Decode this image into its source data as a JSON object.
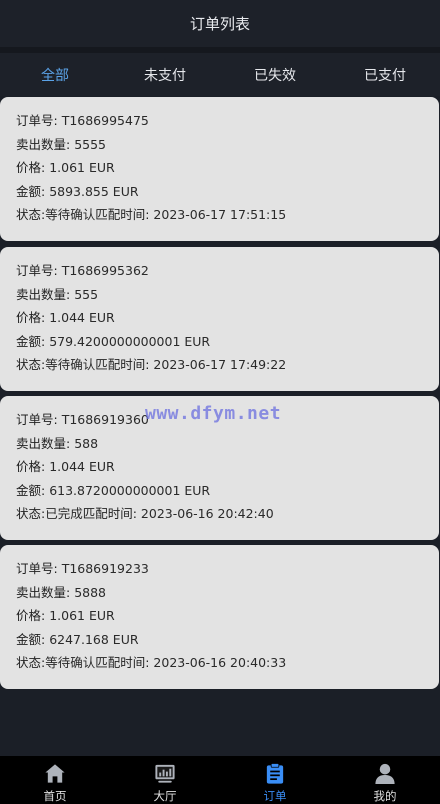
{
  "header": {
    "title": "订单列表"
  },
  "tabs": [
    {
      "label": "全部",
      "active": true
    },
    {
      "label": "未支付",
      "active": false
    },
    {
      "label": "已失效",
      "active": false
    },
    {
      "label": "已支付",
      "active": false
    }
  ],
  "labels": {
    "order_no": "订单号: ",
    "quantity": "卖出数量: ",
    "price": "价格: ",
    "amount": "金额: ",
    "status": "状态:",
    "match_time": "匹配时间: "
  },
  "orders": [
    {
      "order_no": "T1686995475",
      "quantity": "5555",
      "price": "1.061 EUR",
      "amount": "5893.855 EUR",
      "status": "等待确认",
      "match_time": "2023-06-17 17:51:15"
    },
    {
      "order_no": "T1686995362",
      "quantity": "555",
      "price": "1.044 EUR",
      "amount": "579.4200000000001 EUR",
      "status": "等待确认",
      "match_time": "2023-06-17 17:49:22"
    },
    {
      "order_no": "T1686919360",
      "quantity": "588",
      "price": "1.044 EUR",
      "amount": "613.8720000000001 EUR",
      "status": "已完成",
      "match_time": "2023-06-16 20:42:40"
    },
    {
      "order_no": "T1686919233",
      "quantity": "5888",
      "price": "1.061 EUR",
      "amount": "6247.168 EUR",
      "status": "等待确认",
      "match_time": "2023-06-16 20:40:33"
    }
  ],
  "watermark": "www.dfym.net",
  "nav": [
    {
      "label": "首页",
      "icon": "home-icon",
      "active": false
    },
    {
      "label": "大厅",
      "icon": "hall-chart-icon",
      "active": false
    },
    {
      "label": "订单",
      "icon": "clipboard-icon",
      "active": true
    },
    {
      "label": "我的",
      "icon": "user-icon",
      "active": false
    }
  ],
  "colors": {
    "accent": "#3a8ef6",
    "tab_active": "#5ba3e8",
    "card_bg": "#e3e3e3",
    "page_bg": "#1b1f27"
  }
}
